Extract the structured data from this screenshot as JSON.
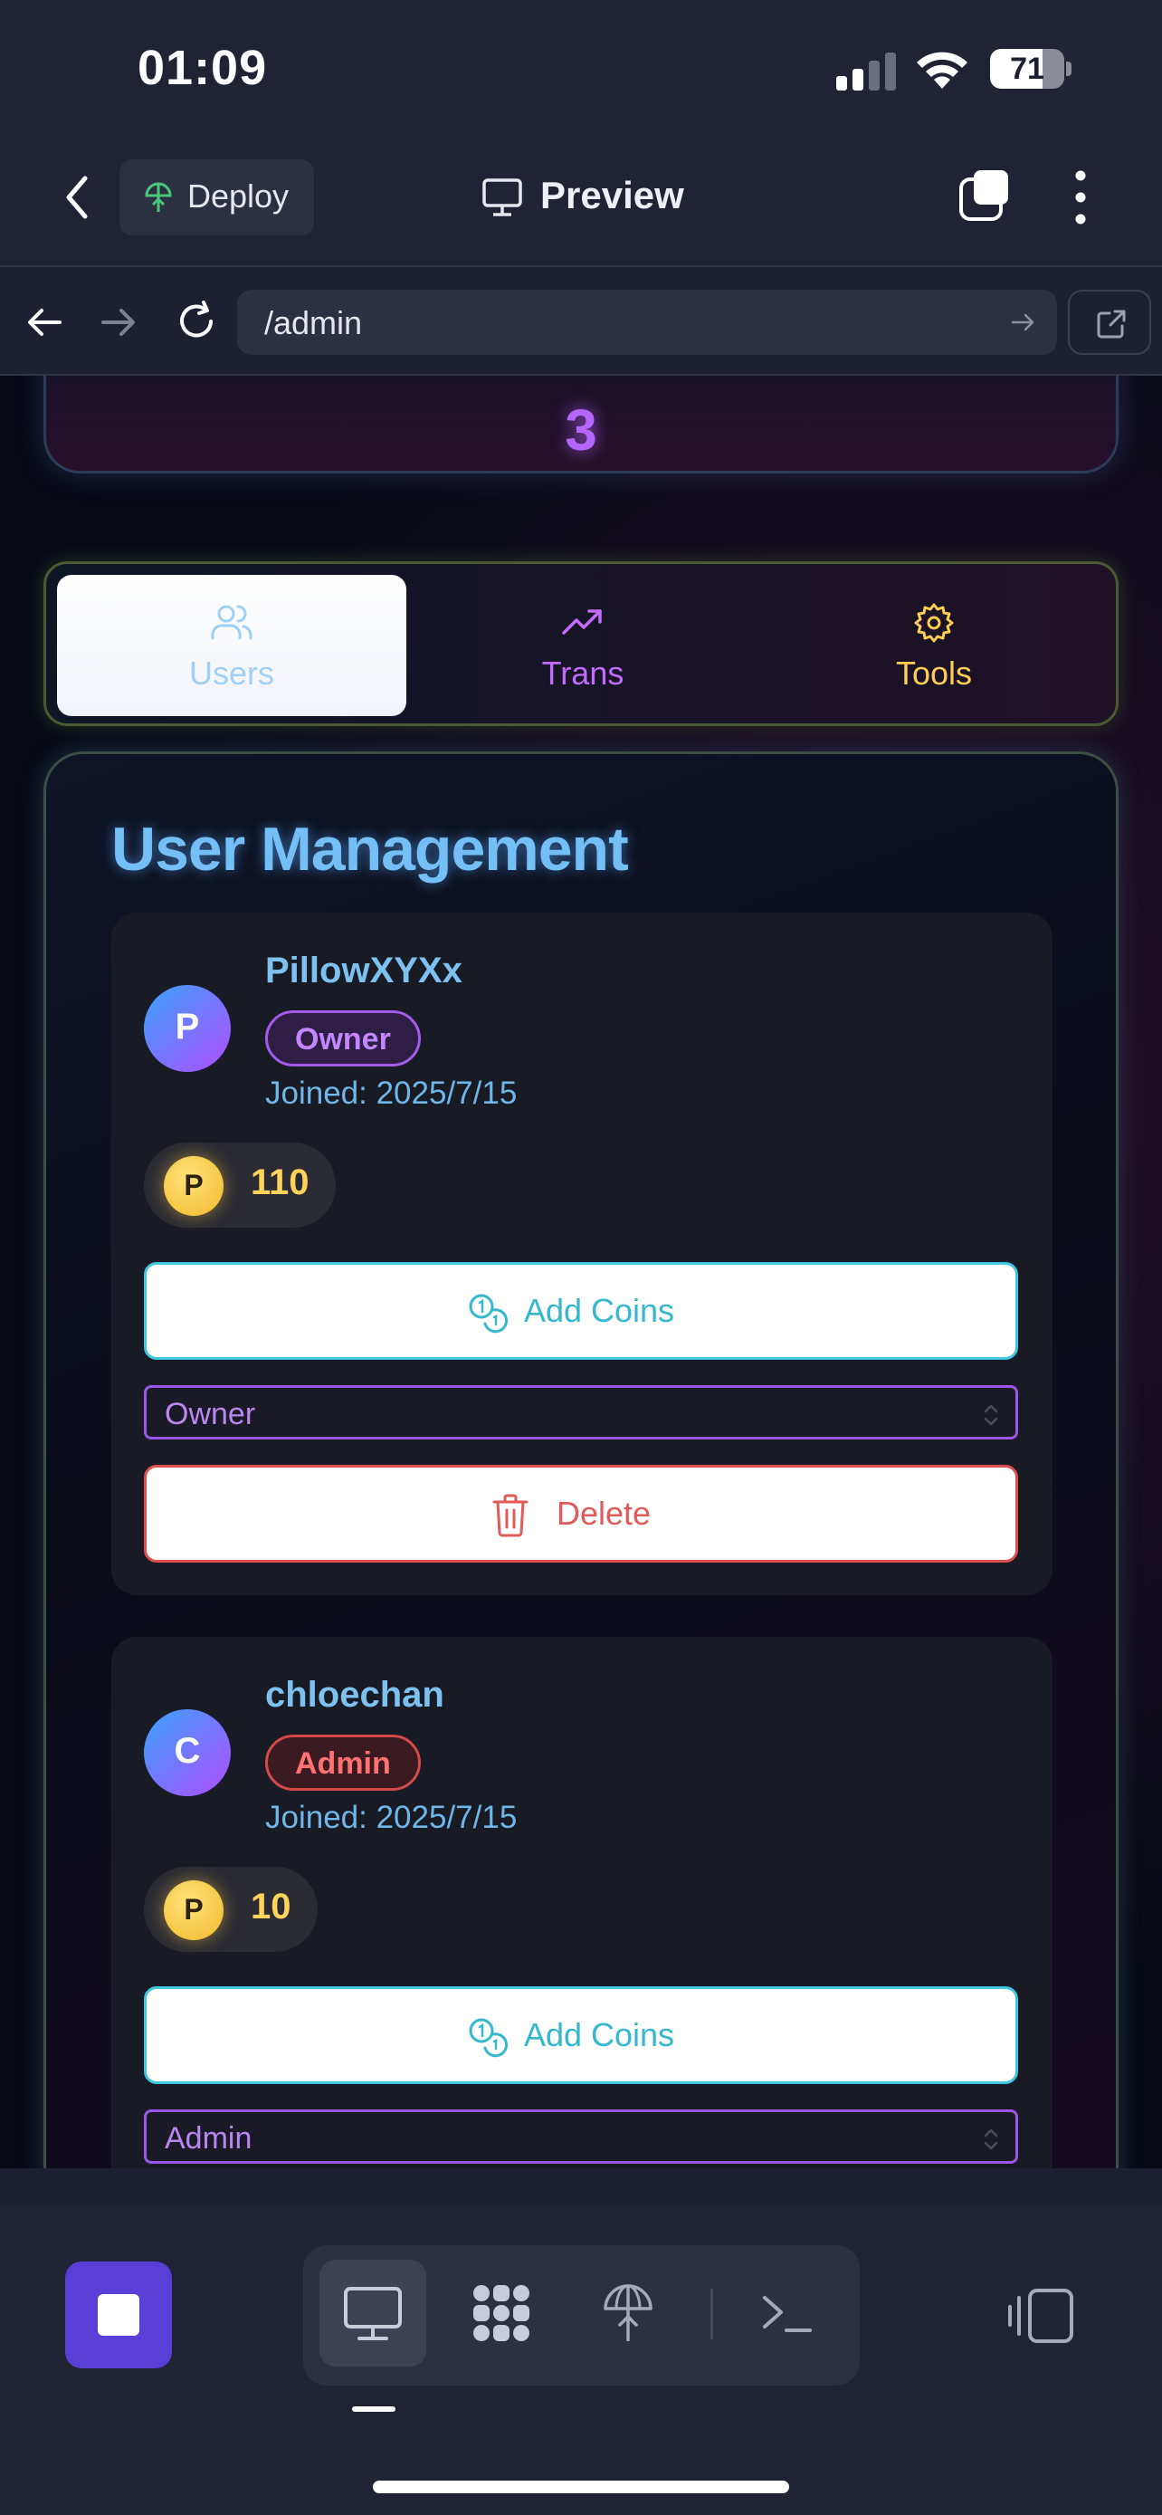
{
  "status_bar": {
    "time": "01:09",
    "battery": "71",
    "battery_level": 0.71
  },
  "toolbar": {
    "deploy_label": "Deploy",
    "title": "Preview"
  },
  "browser": {
    "url": "/admin"
  },
  "stat_card": {
    "value": "3"
  },
  "tabs": [
    {
      "label": "Users",
      "icon": "users-icon",
      "active": true
    },
    {
      "label": "Trans",
      "icon": "trending-up-icon",
      "active": false
    },
    {
      "label": "Tools",
      "icon": "gear-icon",
      "active": false
    }
  ],
  "panel": {
    "title": "User Management"
  },
  "users": [
    {
      "initial": "P",
      "name": "PillowXYXx",
      "role": "Owner",
      "joined": "Joined: 2025/7/15",
      "coin_symbol": "P",
      "coins": "110",
      "add_label": "Add Coins",
      "select_value": "Owner",
      "delete_label": "Delete"
    },
    {
      "initial": "C",
      "name": "chloechan",
      "role": "Admin",
      "joined": "Joined: 2025/7/15",
      "coin_symbol": "P",
      "coins": "10",
      "add_label": "Add Coins",
      "select_value": "Admin"
    }
  ],
  "bottom_toolbar": {
    "modes": [
      "monitor-icon",
      "apps-grid-icon",
      "deploy-icon",
      "terminal-icon"
    ],
    "active_mode": "monitor-icon"
  },
  "colors": {
    "accent_purple": "#5a3fd6",
    "title_blue": "#74bff6",
    "coin_gold": "#ffd25a",
    "delete_red": "#e05a5a",
    "add_cyan": "#35b7cf"
  }
}
